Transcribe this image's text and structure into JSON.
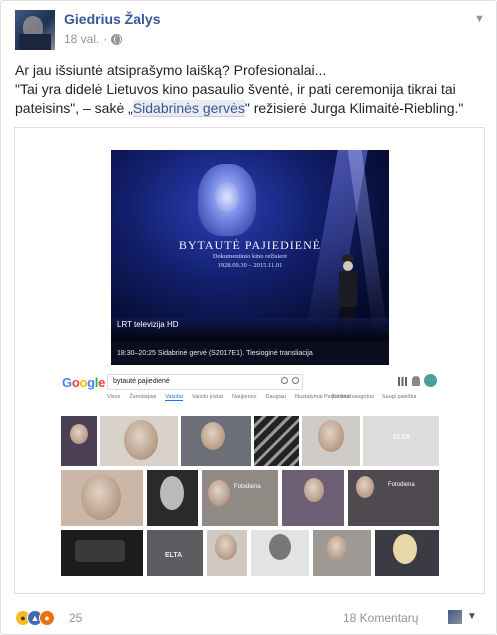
{
  "post": {
    "author": "Giedrius Žalys",
    "time": "18 val.",
    "separator": "·",
    "text_line1": "Ar jau išsiuntė atsiprašymo laišką? Profesionalai...",
    "text_line2a": "\"Tai yra didelė Lietuvos kino pasaulio šventė, ir pati ceremonija tikrai tai pateisins\", – sakė „",
    "text_link": "Sidabrinės gervės",
    "text_line2b": "\" režisierė Jurga Klimaitė-Riebling.\"",
    "options_icon": "chevron-down-icon"
  },
  "tv_frame": {
    "title": "BYTAUTĖ PAJIEDIENĖ",
    "subtitle": "Dokumentinio kino režisierė",
    "dates": "1928.09.30 – 2015.11.01",
    "channel": "LRT televizija HD",
    "ticker": "18:30–20:25 Sidabrinė gervė (S2017E1). Tiesioginė transliacija"
  },
  "google": {
    "logo": "Google",
    "query": "bytauté pajiediené",
    "tabs": [
      "Visos",
      "Žemėlapiai",
      "Vaizdai",
      "Vaizdo įrašai",
      "Naujienos",
      "Daugiau",
      "Nustatymai",
      "Įrankiai"
    ],
    "active_tab": "Vaizdai",
    "right_tabs": [
      "Peržiūrėt išsaugotus",
      "Saugi paieška"
    ],
    "watermarks": [
      "ELTA",
      "Fotodiena",
      "Fotodiena",
      "ELTA"
    ]
  },
  "footer": {
    "reaction_count": "25",
    "comments": "18 Komentarų",
    "reactions": [
      "wow",
      "like",
      "angry"
    ]
  },
  "colors": {
    "link_blue": "#365899",
    "meta_gray": "#90949c",
    "text": "#1d2129"
  }
}
